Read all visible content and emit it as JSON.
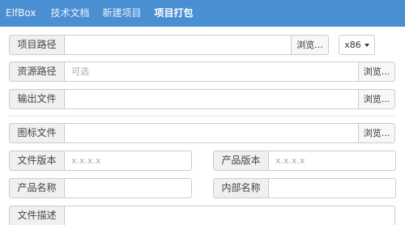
{
  "navbar": {
    "brand": "ElfBox",
    "items": [
      "技术文档",
      "新建项目",
      "项目打包"
    ]
  },
  "form": {
    "project_path": {
      "label": "项目路径",
      "value": "",
      "placeholder": "",
      "browse": "浏览..."
    },
    "arch": {
      "value": "x86"
    },
    "resource_path": {
      "label": "资源路径",
      "value": "",
      "placeholder": "可选",
      "browse": "浏览..."
    },
    "output_file": {
      "label": "输出文件",
      "value": "",
      "placeholder": "",
      "browse": "浏览..."
    },
    "icon_file": {
      "label": "图标文件",
      "value": "",
      "placeholder": "",
      "browse": "浏览..."
    },
    "file_version": {
      "label": "文件版本",
      "value": "",
      "placeholder": "x.x.x.x"
    },
    "product_version": {
      "label": "产品版本",
      "value": "",
      "placeholder": "x.x.x.x"
    },
    "product_name": {
      "label": "产品名称",
      "value": "",
      "placeholder": ""
    },
    "internal_name": {
      "label": "内部名称",
      "value": "",
      "placeholder": ""
    },
    "file_description": {
      "label": "文件描述",
      "value": "",
      "placeholder": ""
    }
  },
  "colors": {
    "navbar_bg": "#4a8fd2",
    "border": "#cccccc",
    "label_bg": "#f0f0f0"
  }
}
